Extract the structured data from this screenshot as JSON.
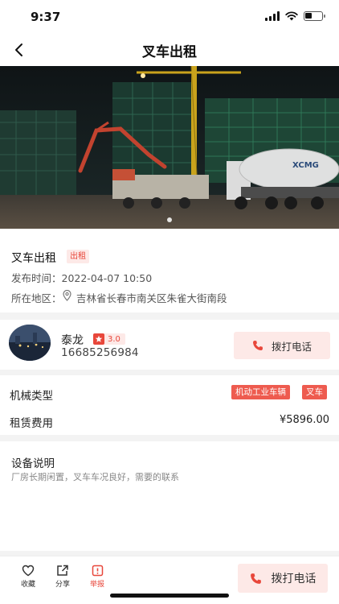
{
  "status_bar": {
    "time": "9:37"
  },
  "nav": {
    "title": "叉车出租"
  },
  "listing": {
    "title": "叉车出租",
    "tag": "出租",
    "published": "发布时间：2022-04-07 10:50",
    "region_label": "所在地区：",
    "region_value": "吉林省长春市南关区朱雀大街南段"
  },
  "contact": {
    "name": "泰龙",
    "rating": "3.0",
    "phone": "16685256984",
    "call_label": "拨打电话"
  },
  "specs": {
    "machine_type_label": "机械类型",
    "machine_type_tags": [
      "机动工业车辆",
      "叉车"
    ],
    "rent_label": "租赁费用",
    "rent_value": "¥5896.00"
  },
  "description": {
    "title": "设备说明",
    "text": "厂房长期闲置，叉车车况良好，需要的联系"
  },
  "bottom_bar": {
    "favorite_label": "收藏",
    "share_label": "分享",
    "report_label": "举报",
    "call_label": "拨打电话"
  },
  "hero_truck_brand": "XCMG",
  "colors": {
    "accent": "#e8473b",
    "accent_light": "#fde9e7"
  }
}
